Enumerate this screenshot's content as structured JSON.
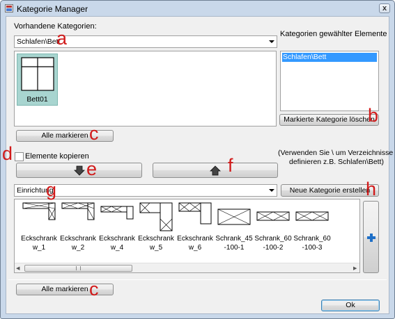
{
  "window": {
    "title": "Kategorie Manager",
    "close_glyph": "x"
  },
  "top": {
    "existing_label": "Vorhandene Kategorien:",
    "category_combo_value": "Schlafen\\Bett",
    "selected_label": "Kategorien gewählter Elemente",
    "selected_list": [
      "Schlafen\\Bett"
    ],
    "tile_label": "Bett01",
    "delete_button": "Markierte Kategorie löschen",
    "select_all_button": "Alle markieren"
  },
  "middle": {
    "copy_checkbox_label": "Elemente kopieren",
    "copy_checked": false,
    "hint_line1": "(Verwenden Sie \\ um Verzeichnisse zu",
    "hint_line2": "definieren z.B. Schlafen\\Bett)",
    "down_icon": "arrow-down-icon",
    "up_icon": "arrow-up-icon"
  },
  "bottom": {
    "category_combo_value": "Einrichtung",
    "new_category_button": "Neue Kategorie erstellen",
    "items": [
      {
        "line1": "Eckschrank",
        "line2": "w_1"
      },
      {
        "line1": "Eckschrank",
        "line2": "w_2"
      },
      {
        "line1": "Eckschrank",
        "line2": "w_4"
      },
      {
        "line1": "Eckschrank",
        "line2": "w_5"
      },
      {
        "line1": "Eckschrank",
        "line2": "w_6"
      },
      {
        "line1": "Schrank_45",
        "line2": "-100-1"
      },
      {
        "line1": "Schrank_60",
        "line2": "-100-2"
      },
      {
        "line1": "Schrank_60",
        "line2": "-100-3"
      }
    ],
    "add_icon": "plus-icon",
    "select_all_button": "Alle markieren",
    "ok_button": "Ok"
  },
  "annotations": {
    "a": "a",
    "b": "b",
    "c1": "c",
    "c2": "c",
    "d": "d",
    "e": "e",
    "f": "f",
    "g": "g",
    "h": "h"
  },
  "colors": {
    "frame": "#c9d8ea",
    "selection": "#3399ff",
    "tile": "#a8d5d0",
    "annotation": "#d11a1a",
    "plus": "#1e6fc7"
  }
}
